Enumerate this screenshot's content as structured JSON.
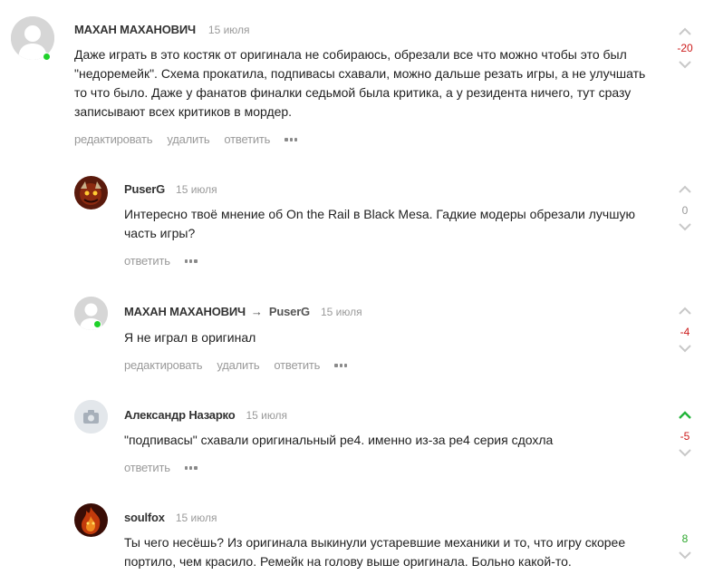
{
  "comments": [
    {
      "author": "МАХАН МАХАНОВИЧ",
      "date": "15 июля",
      "text": "Даже играть в это костяк от оригинала не собираюсь, обрезали все что можно чтобы это был \"недоремейк\". Схема прокатила, подпивасы схавали, можно дальше резать игры, а не улучшать то что было. Даже у фанатов финалки седьмой была критика, а у резидента ничего, тут сразу записывают всех критиков в мордер.",
      "actions": [
        "редактировать",
        "удалить",
        "ответить"
      ],
      "score": "-20",
      "score_color": "#cc1b1b",
      "avatar": "default-avatar",
      "online": true
    },
    {
      "author": "PuserG",
      "date": "15 июля",
      "text": "Интересно твоё мнение об On the Rail в Black Mesa. Гадкие модеры обрезали лучшую часть игры?",
      "actions": [
        "ответить"
      ],
      "score": "0",
      "score_color": "#999999",
      "avatar": "doom-avatar",
      "online": false
    },
    {
      "author": "МАХАН МАХАНОВИЧ",
      "reply_to": "PuserG",
      "date": "15 июля",
      "text": "Я не играл в оригинал",
      "actions": [
        "редактировать",
        "удалить",
        "ответить"
      ],
      "score": "-4",
      "score_color": "#cc1b1b",
      "avatar": "default-avatar",
      "online": true
    },
    {
      "author": "Александр Назарко",
      "date": "15 июля",
      "text": "\"подпивасы\" схавали оригинальный ре4. именно из-за ре4 серия сдохла",
      "actions": [
        "ответить"
      ],
      "score": "-5",
      "score_color": "#cc1b1b",
      "upvoted": true,
      "avatar": "camera-avatar",
      "online": false
    },
    {
      "author": "soulfox",
      "date": "15 июля",
      "text": "Ты чего несёшь? Из оригинала выкинули устаревшие механики и то, что игру скорее портило, чем красило. Ремейк на голову выше оригинала. Больно какой-то.",
      "actions": [],
      "score": "8",
      "score_color": "#2ea82e",
      "avatar": "fire-avatar",
      "online": false
    }
  ],
  "colors": {
    "accent_green": "#22b43a",
    "negative": "#cc1b1b",
    "positive": "#2ea82e",
    "muted": "#9a9a9a"
  }
}
